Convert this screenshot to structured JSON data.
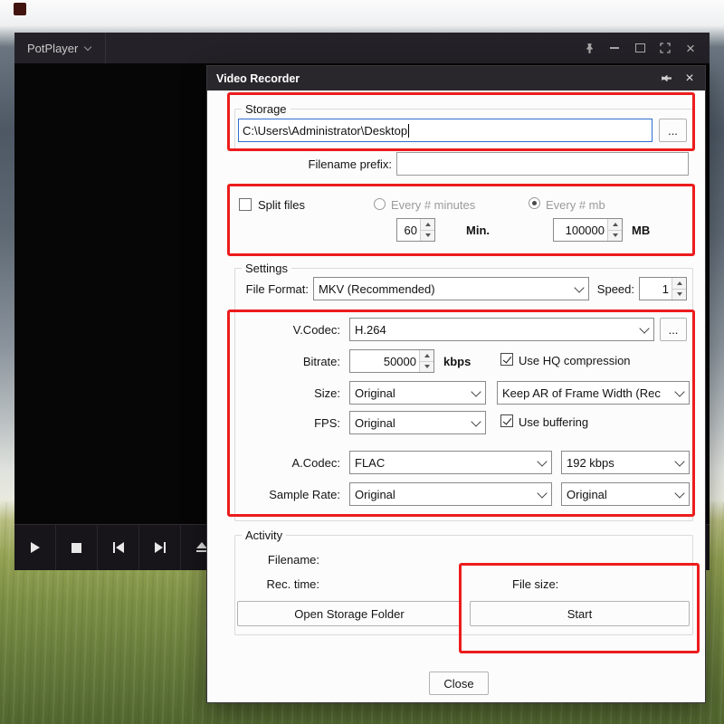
{
  "colors": {
    "annotation_red": "#ec1c1c",
    "dialog_titlebar": "#29272c",
    "focus_blue": "#2f6fce"
  },
  "icons": {
    "close_glyph": "×"
  },
  "player": {
    "title": "PotPlayer",
    "controls": [
      "play",
      "stop",
      "previous",
      "next",
      "open"
    ]
  },
  "dialog": {
    "title": "Video Recorder",
    "storage": {
      "legend": "Storage",
      "path": "C:\\Users\\Administrator\\Desktop",
      "browse_label": "..."
    },
    "prefix": {
      "label": "Filename prefix:",
      "value": ""
    },
    "split": {
      "checkbox_label": "Split files",
      "minutes_radio_label": "Every # minutes",
      "mb_radio_label": "Every # mb",
      "minutes_value": "60",
      "minutes_unit": "Min.",
      "mb_value": "100000",
      "mb_unit": "MB"
    },
    "settings": {
      "legend": "Settings",
      "file_format": {
        "label": "File Format:",
        "value": "MKV (Recommended)"
      },
      "speed": {
        "label": "Speed:",
        "value": "1"
      },
      "vcodec": {
        "label": "V.Codec:",
        "value": "H.264",
        "browse_label": "..."
      },
      "bitrate": {
        "label": "Bitrate:",
        "value": "50000",
        "unit": "kbps"
      },
      "hq_compression_label": "Use HQ compression",
      "size": {
        "label": "Size:",
        "value": "Original"
      },
      "aspect": {
        "value": "Keep AR of Frame Width (Rec"
      },
      "fps": {
        "label": "FPS:",
        "value": "Original"
      },
      "buffering_label": "Use buffering",
      "acodec": {
        "label": "A.Codec:",
        "value": "FLAC"
      },
      "audio_bitrate": {
        "value": "192 kbps"
      },
      "sample_rate": {
        "label": "Sample Rate:",
        "value": "Original"
      },
      "sample_rate_right": {
        "value": "Original"
      }
    },
    "activity": {
      "legend": "Activity",
      "filename_label": "Filename:",
      "rec_time_label": "Rec. time:",
      "file_size_label": "File size:",
      "open_folder_label": "Open Storage Folder",
      "start_label": "Start"
    },
    "close_label": "Close"
  }
}
